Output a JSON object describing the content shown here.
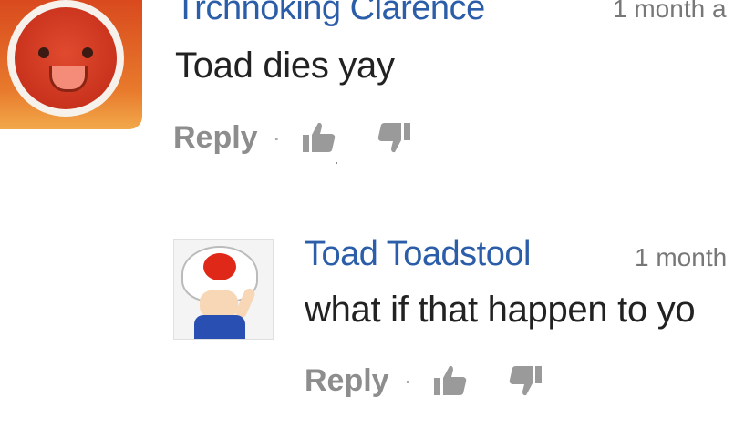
{
  "comments": [
    {
      "author": "Trchnoking Clarence",
      "timestamp": "1 month a",
      "text": "Toad dies yay",
      "reply_label": "Reply",
      "separator": "·",
      "avatar_icon": "taiko-drum-avatar",
      "like_icon": "thumbs-up-icon",
      "dislike_icon": "thumbs-down-icon"
    },
    {
      "author": "Toad Toadstool",
      "timestamp": "1 month",
      "text": "what if that happen to yo",
      "reply_label": "Reply",
      "separator": "·",
      "avatar_icon": "toad-avatar",
      "like_icon": "thumbs-up-icon",
      "dislike_icon": "thumbs-down-icon"
    }
  ],
  "colors": {
    "author": "#2b5da8",
    "timestamp": "#777777",
    "text": "#222222",
    "reply": "#8d8d8d",
    "icon": "#9a9a9a"
  }
}
